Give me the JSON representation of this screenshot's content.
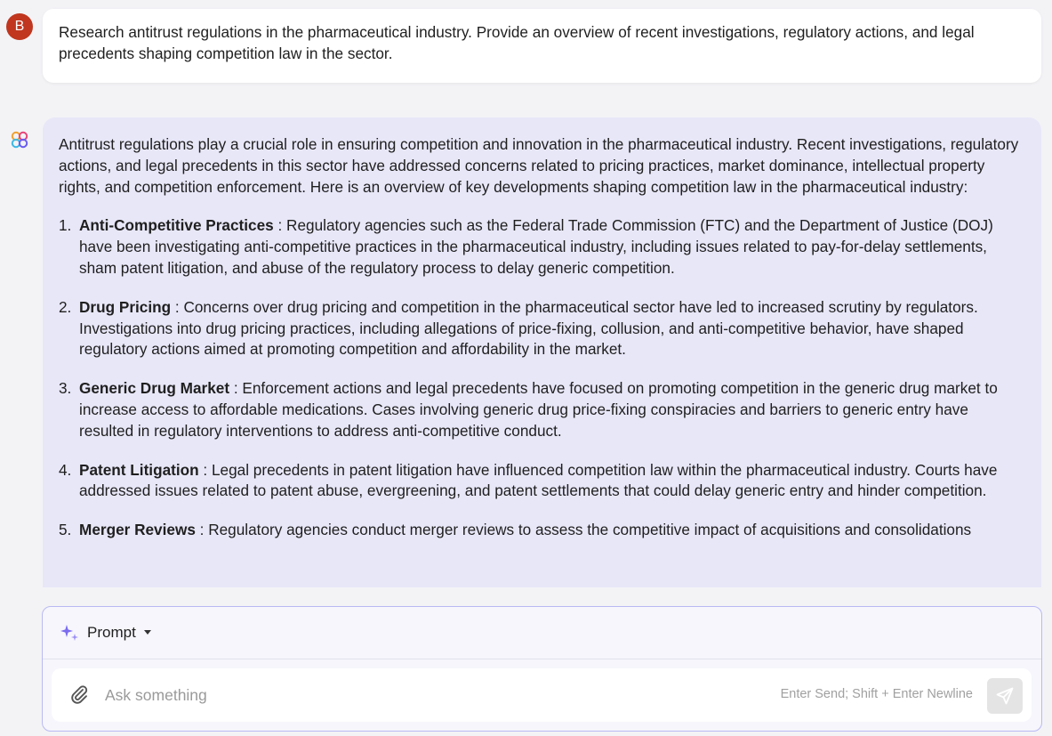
{
  "user": {
    "avatar_letter": "B",
    "message": "Research antitrust regulations in the pharmaceutical industry. Provide an overview of recent investigations, regulatory actions, and legal precedents shaping competition law in the sector."
  },
  "assistant": {
    "intro": "Antitrust regulations play a crucial role in ensuring competition and innovation in the pharmaceutical industry. Recent investigations, regulatory actions, and legal precedents in this sector have addressed concerns related to pricing practices, market dominance, intellectual property rights, and competition enforcement. Here is an overview of key developments shaping competition law in the pharmaceutical industry:",
    "items": [
      {
        "num": "1.",
        "title": "Anti-Competitive Practices",
        "text": " : Regulatory agencies such as the Federal Trade Commission (FTC) and the Department of Justice (DOJ) have been investigating anti-competitive practices in the pharmaceutical industry, including issues related to pay-for-delay settlements, sham patent litigation, and abuse of the regulatory process to delay generic competition."
      },
      {
        "num": "2.",
        "title": "Drug Pricing",
        "text": " : Concerns over drug pricing and competition in the pharmaceutical sector have led to increased scrutiny by regulators. Investigations into drug pricing practices, including allegations of price-fixing, collusion, and anti-competitive behavior, have shaped regulatory actions aimed at promoting competition and affordability in the market."
      },
      {
        "num": "3.",
        "title": "Generic Drug Market",
        "text": " : Enforcement actions and legal precedents have focused on promoting competition in the generic drug market to increase access to affordable medications. Cases involving generic drug price-fixing conspiracies and barriers to generic entry have resulted in regulatory interventions to address anti-competitive conduct."
      },
      {
        "num": "4.",
        "title": "Patent Litigation",
        "text": " : Legal precedents in patent litigation have influenced competition law within the pharmaceutical industry. Courts have addressed issues related to patent abuse, evergreening, and patent settlements that could delay generic entry and hinder competition."
      },
      {
        "num": "5.",
        "title": "Merger Reviews",
        "text": " : Regulatory agencies conduct merger reviews to assess the competitive impact of acquisitions and consolidations"
      }
    ]
  },
  "composer": {
    "mode_label": "Prompt",
    "placeholder": "Ask something",
    "hint": "Enter Send; Shift + Enter Newline"
  },
  "colors": {
    "user_avatar": "#c0361e",
    "assistant_bubble": "#e8e7f8",
    "composer_border": "#b9b9f3"
  },
  "icons": {
    "assistant": "multicolor-flower-icon",
    "mode": "sparkle-icon",
    "attach": "paperclip-icon",
    "send": "send-icon"
  }
}
